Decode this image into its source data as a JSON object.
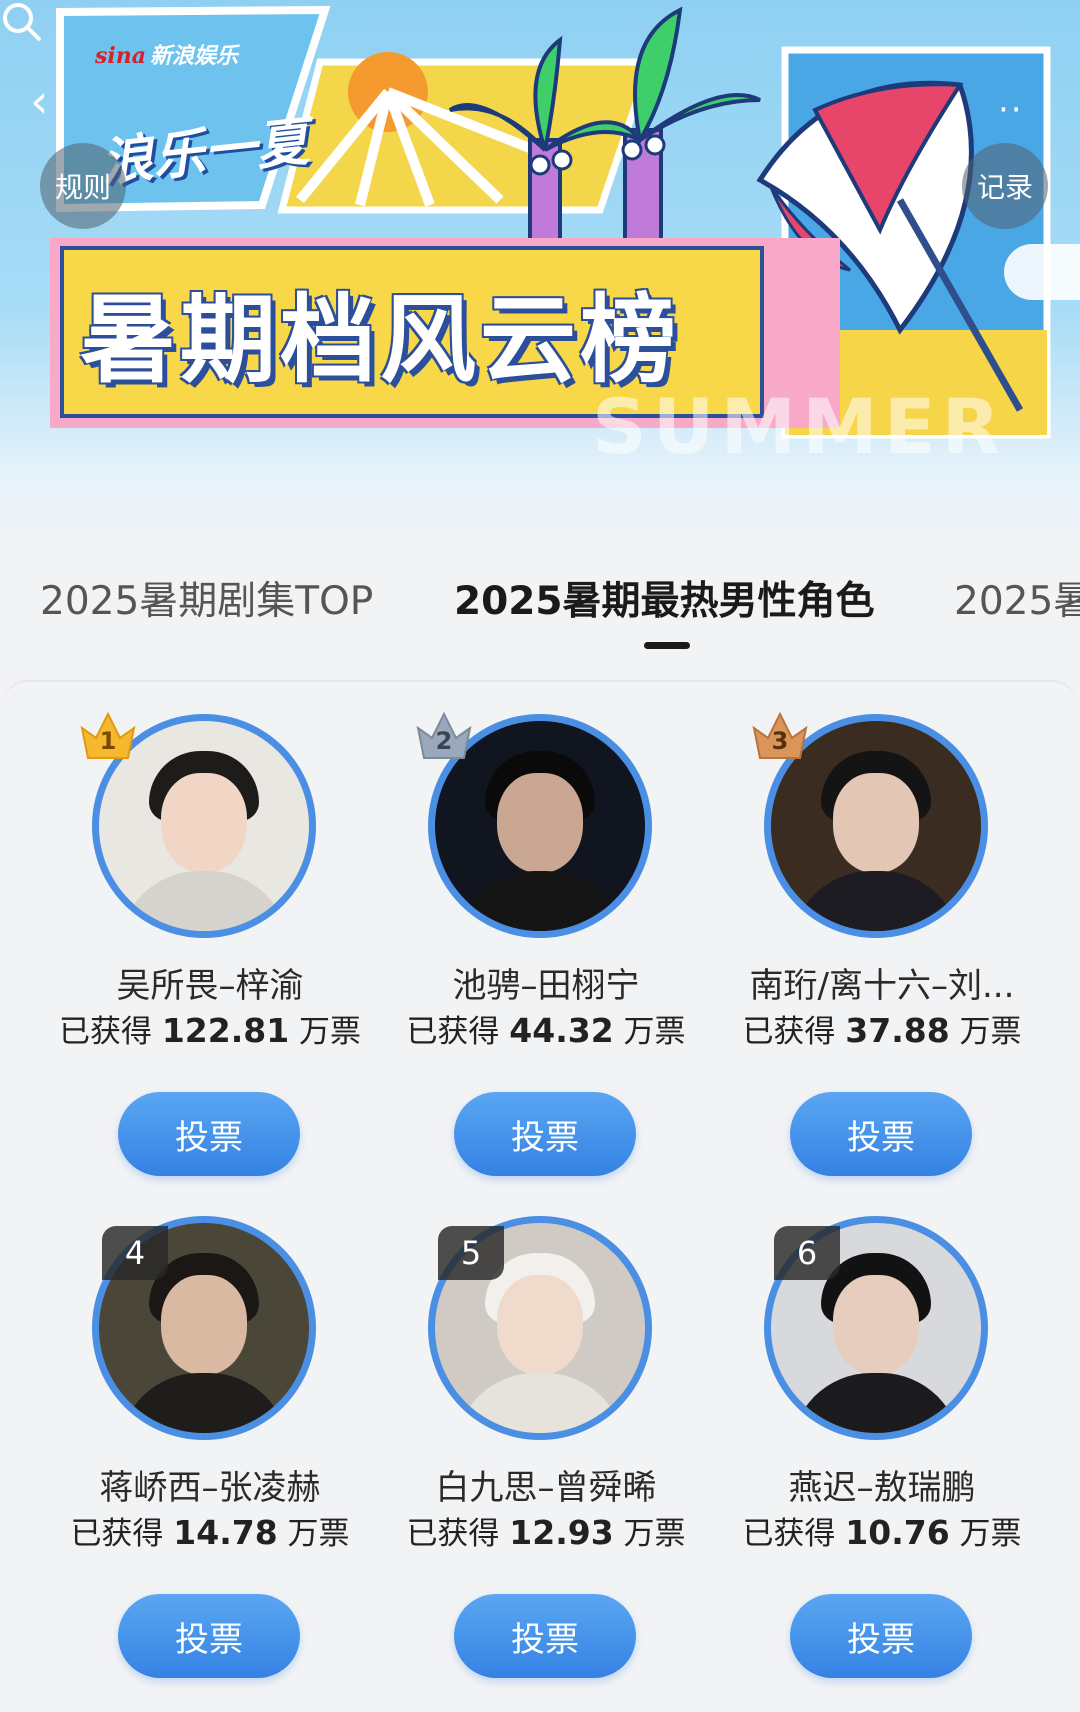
{
  "banner": {
    "brand_prefix": "sina",
    "brand_name": "新浪娱乐",
    "slogan": "浪乐一夏",
    "title": "暑期档风云榜",
    "summer_word": "SUMMER"
  },
  "header": {
    "back_icon": "chevron-left-icon",
    "rules_label": "规则",
    "record_label": "记录",
    "more_icon": "more-dots-icon",
    "search_icon": "search-icon"
  },
  "tabs": [
    {
      "label": "2025暑期剧集TOP"
    },
    {
      "label": "2025暑期最热男性角色"
    },
    {
      "label": "2025暑"
    }
  ],
  "active_tab": "2025暑期最热男性角色",
  "candidates": [
    {
      "rank": "1",
      "name": "吴所畏–梓渝",
      "votes_prefix": "已获得",
      "votes": "122.81",
      "votes_unit": "万票",
      "button": "投票"
    },
    {
      "rank": "2",
      "name": "池骋–田栩宁",
      "votes_prefix": "已获得",
      "votes": "44.32",
      "votes_unit": "万票",
      "button": "投票"
    },
    {
      "rank": "3",
      "name": "南珩/离十六–刘...",
      "votes_prefix": "已获得",
      "votes": "37.88",
      "votes_unit": "万票",
      "button": "投票"
    },
    {
      "rank": "4",
      "name": "蒋峤西–张凌赫",
      "votes_prefix": "已获得",
      "votes": "14.78",
      "votes_unit": "万票",
      "button": "投票"
    },
    {
      "rank": "5",
      "name": "白九思–曾舜晞",
      "votes_prefix": "已获得",
      "votes": "12.93",
      "votes_unit": "万票",
      "button": "投票"
    },
    {
      "rank": "6",
      "name": "燕迟–敖瑞鹏",
      "votes_prefix": "已获得",
      "votes": "10.76",
      "votes_unit": "万票",
      "button": "投票"
    }
  ],
  "colors": {
    "button": "#3582e4",
    "ring": "#4a8fe3",
    "gold": "#f5b82e",
    "silver": "#9aa8bb",
    "bronze": "#d9955a"
  }
}
